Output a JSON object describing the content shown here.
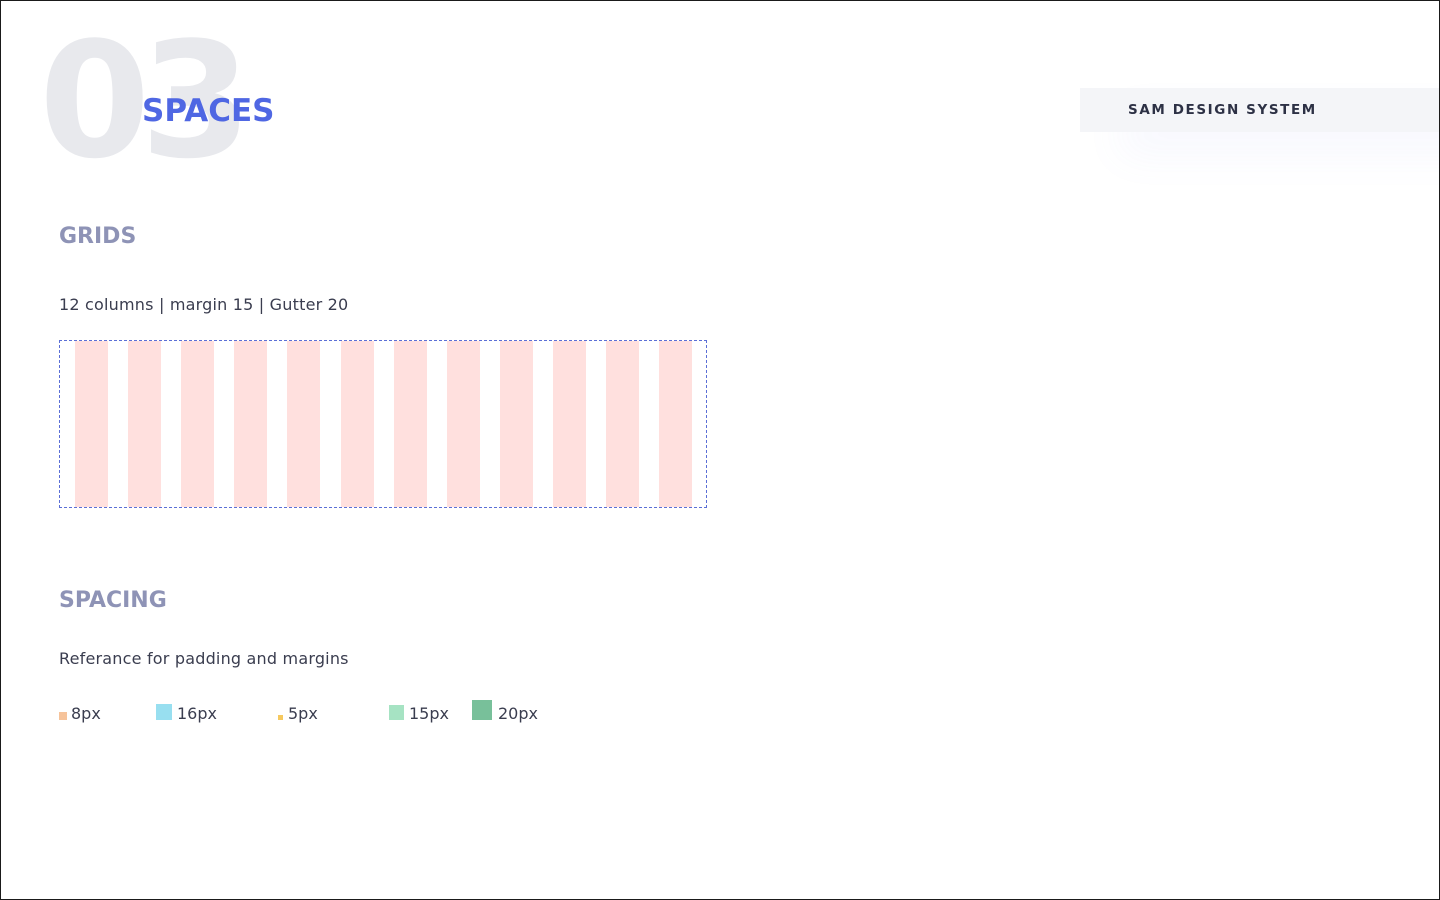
{
  "hero": {
    "section_number": "03",
    "title": "SPACES"
  },
  "brand_tag": {
    "label": "SAM DESIGN SYSTEM"
  },
  "grids": {
    "heading": "GRIDS",
    "description": "12 columns | margin 15 | Gutter 20",
    "columns": 12,
    "column_color": "#ffe0de",
    "guide_color": "#5b6fd6"
  },
  "spacing": {
    "heading": "SPACING",
    "description": "Referance for padding and margins",
    "swatches": [
      {
        "label": "8px",
        "color": "#f6c39a"
      },
      {
        "label": "16px",
        "color": "#98dff0"
      },
      {
        "label": "5px",
        "color": "#f6c95f"
      },
      {
        "label": "15px",
        "color": "#a6e3c3"
      },
      {
        "label": "20px",
        "color": "#78c09a"
      }
    ]
  },
  "colors": {
    "accent": "#4f67e3",
    "heading": "#8e93b6",
    "body_text": "#3a3d4f",
    "watermark": "#e8e9ed",
    "tag_background": "#f4f5f8"
  }
}
